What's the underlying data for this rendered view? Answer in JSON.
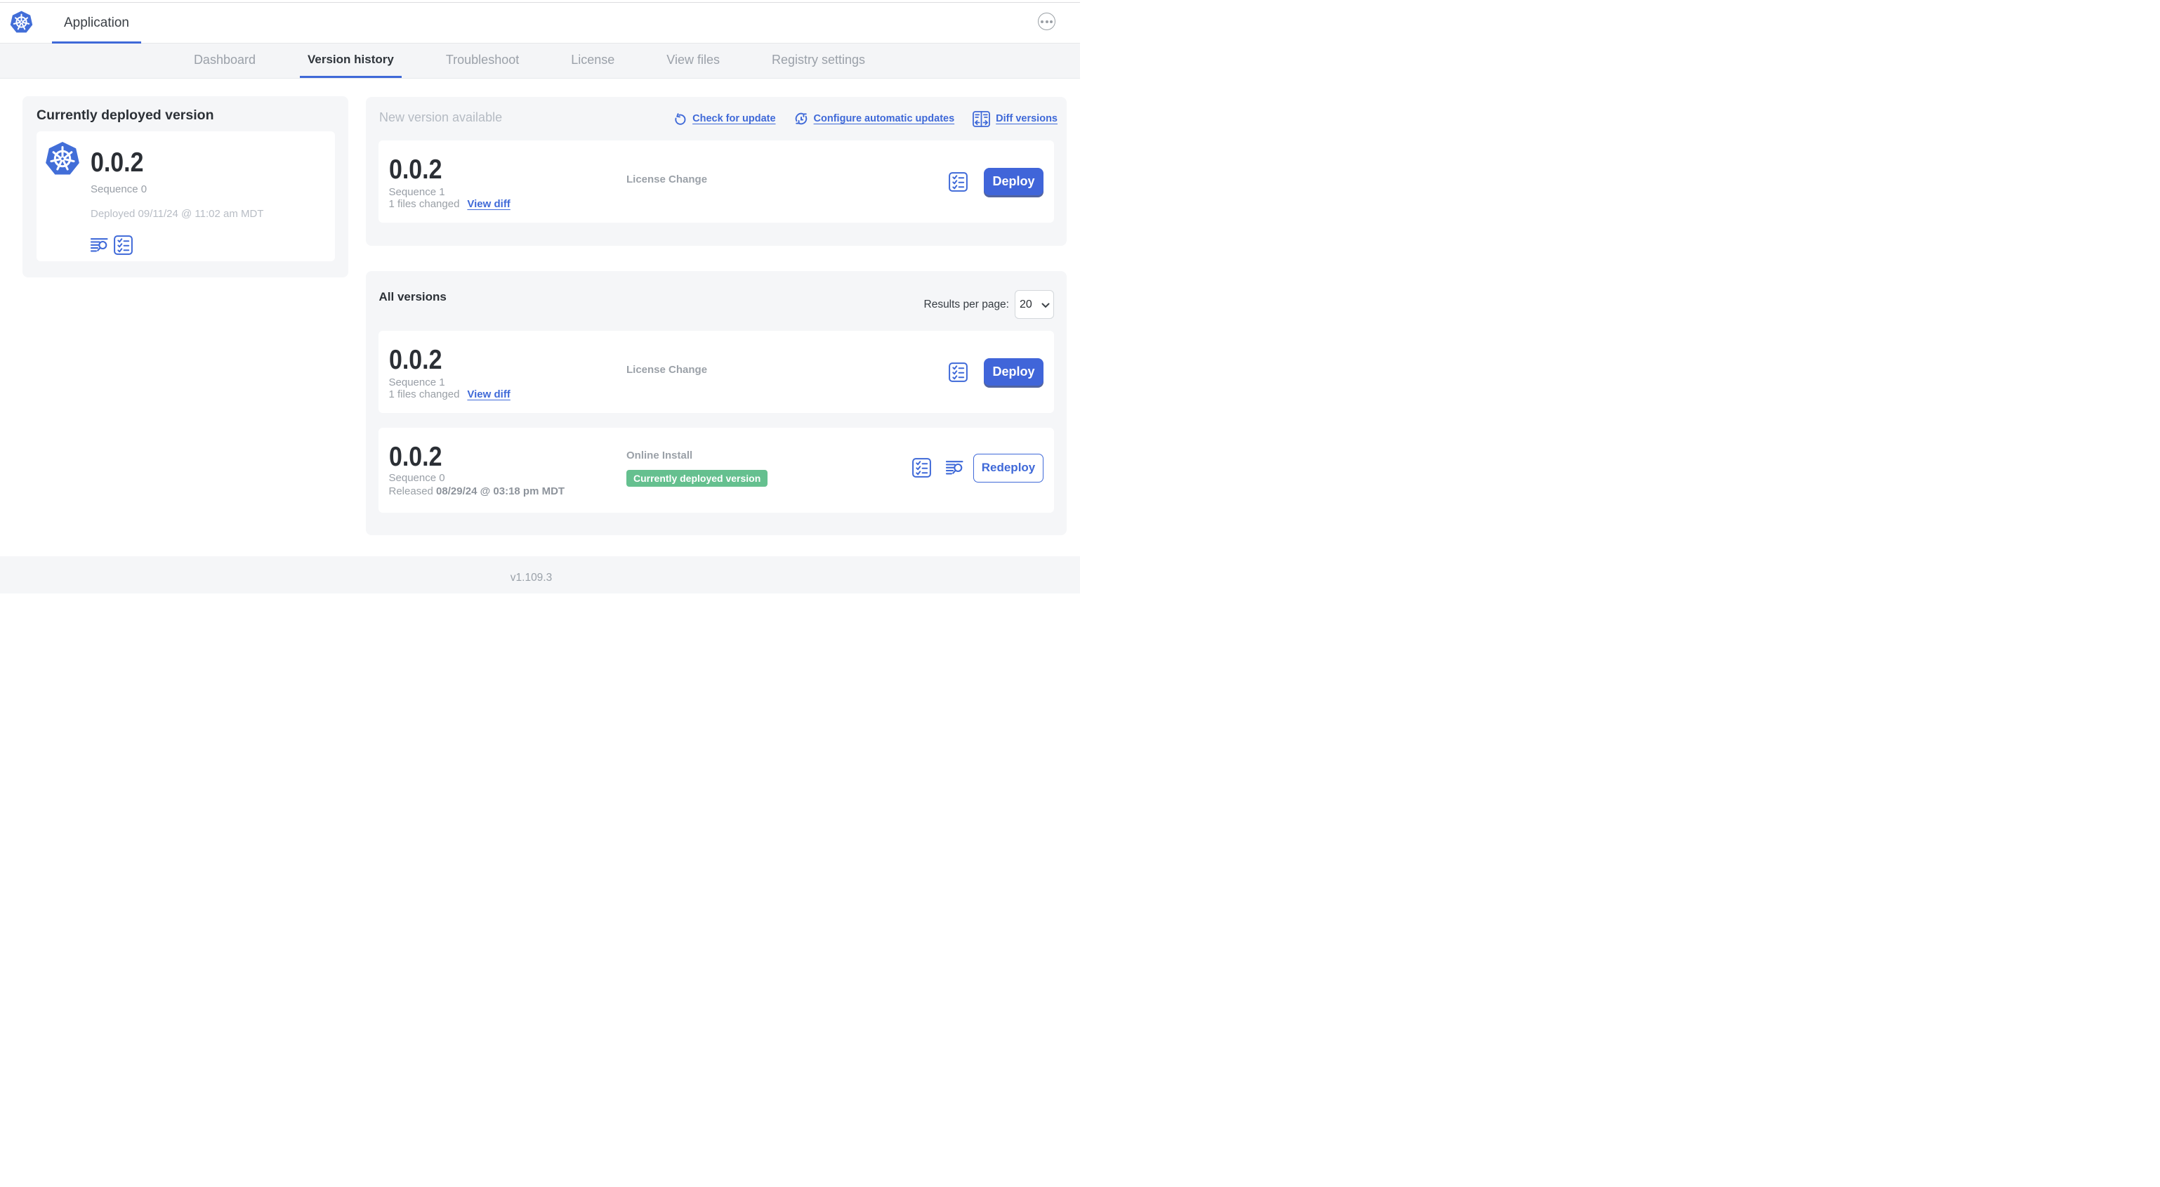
{
  "header": {
    "app_tab": "Application"
  },
  "nav": {
    "tabs": [
      {
        "label": "Dashboard",
        "active": false
      },
      {
        "label": "Version history",
        "active": true
      },
      {
        "label": "Troubleshoot",
        "active": false
      },
      {
        "label": "License",
        "active": false
      },
      {
        "label": "View files",
        "active": false
      },
      {
        "label": "Registry settings",
        "active": false
      }
    ]
  },
  "current": {
    "title": "Currently deployed version",
    "version": "0.0.2",
    "sequence": "Sequence 0",
    "deployed": "Deployed 09/11/24 @ 11:02 am MDT"
  },
  "new_version": {
    "title": "New version available",
    "check_for_update": "Check for update",
    "configure_updates": "Configure automatic updates",
    "diff_versions": "Diff versions",
    "version": "0.0.2",
    "sequence": "Sequence 1",
    "files_changed": "1 files changed",
    "view_diff": "View diff",
    "source": "License Change",
    "deploy": "Deploy"
  },
  "all_versions": {
    "title": "All versions",
    "results_label": "Results per page:",
    "results_value": "20",
    "rows": [
      {
        "version": "0.0.2",
        "sequence": "Sequence 1",
        "files_changed": "1 files changed",
        "view_diff": "View diff",
        "source": "License Change",
        "action": "Deploy"
      },
      {
        "version": "0.0.2",
        "sequence": "Sequence 0",
        "released_prefix": "Released ",
        "released_date": "08/29/24 @ 03:18 pm MDT",
        "source": "Online Install",
        "badge": "Currently deployed version",
        "action": "Redeploy"
      }
    ]
  },
  "footer": {
    "version": "v1.109.3"
  },
  "colors": {
    "accent_blue": "#3f69d8",
    "deploy_blue": "#4165d9",
    "k8s_blue": "#426ed8",
    "badge_green": "#65c08f",
    "card_gray": "#f5f6f8"
  }
}
